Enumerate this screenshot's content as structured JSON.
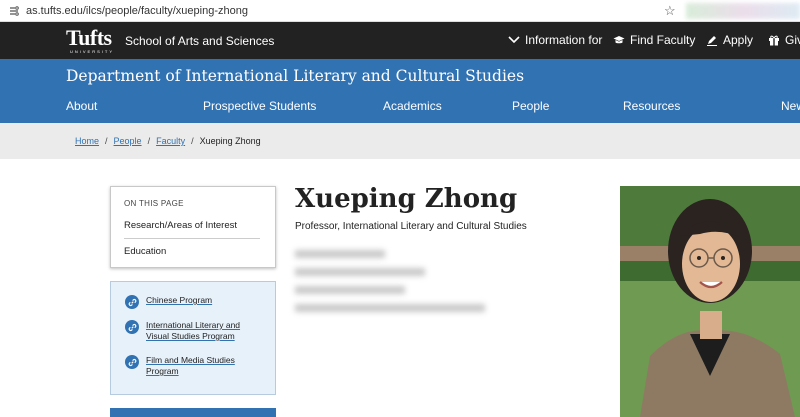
{
  "browser": {
    "url": "as.tufts.edu/ilcs/people/faculty/xueping-zhong"
  },
  "topbar": {
    "logo_text": "Tufts",
    "logo_sub": "UNIVERSITY",
    "school": "School of Arts and Sciences",
    "nav": [
      {
        "label": "Information for",
        "icon": "chevron-down-icon"
      },
      {
        "label": "Find Faculty",
        "icon": "mortarboard-icon"
      },
      {
        "label": "Apply",
        "icon": "pencil-icon"
      },
      {
        "label": "Giv",
        "icon": "gift-icon"
      }
    ]
  },
  "department": {
    "title": "Department of International Literary and Cultural Studies"
  },
  "mainnav": [
    "About",
    "Prospective Students",
    "Academics",
    "People",
    "Resources",
    "New"
  ],
  "breadcrumb": {
    "home": "Home",
    "people": "People",
    "faculty": "Faculty",
    "current": "Xueping Zhong"
  },
  "onpage": {
    "heading": "ON THIS PAGE",
    "items": [
      "Research/Areas of Interest",
      "Education"
    ]
  },
  "programs": [
    {
      "line1": "Chinese Program",
      "line2": ""
    },
    {
      "line1": "International Literary and",
      "line2": "Visual Studies Program"
    },
    {
      "line1": "Film and Media Studies",
      "line2": "Program"
    }
  ],
  "profile": {
    "name": "Xueping Zhong",
    "title": "Professor, International Literary and Cultural Studies"
  },
  "colors": {
    "brand_blue": "#3172b3",
    "topbar": "#222222"
  }
}
